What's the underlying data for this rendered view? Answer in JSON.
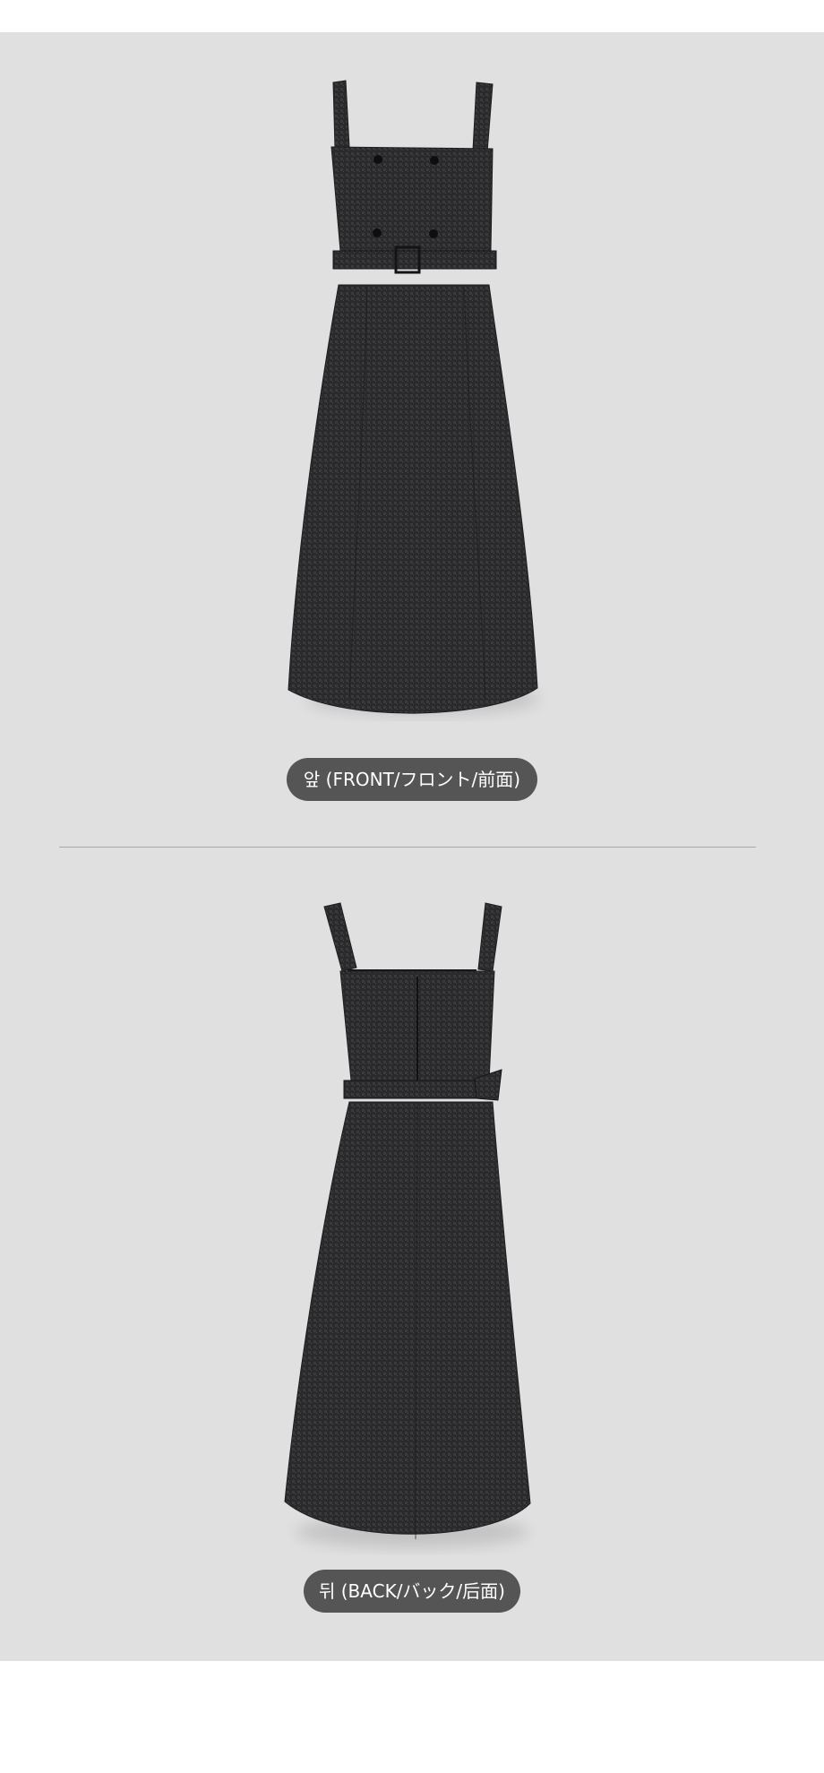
{
  "product_images": {
    "front": {
      "label": "앞 (FRONT/フロント/前面)",
      "icon": "dress-front-image"
    },
    "back": {
      "label": "뒤 (BACK/バック/后面)",
      "icon": "dress-back-image"
    }
  },
  "colors": {
    "panel_background": "#e0e0e0",
    "label_pill": "#555555",
    "label_text": "#ffffff",
    "divider": "#a8a8a8",
    "fabric": "#2b2b2d"
  }
}
